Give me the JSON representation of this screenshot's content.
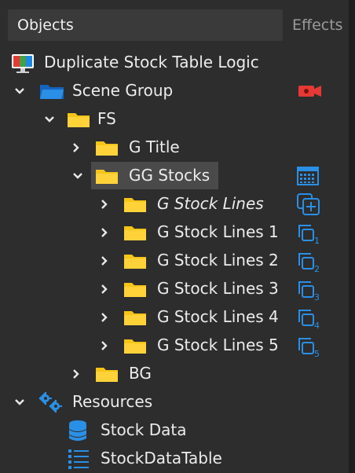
{
  "header": {
    "objects_tab": "Objects",
    "effects_tab": "Effects"
  },
  "tree": {
    "root_label": "Duplicate Stock Table Logic",
    "scene_group": "Scene Group",
    "fs": "FS",
    "g_title": "G Title",
    "gg_stocks": "GG Stocks",
    "g_stock_lines": "G Stock Lines",
    "g_stock_lines_1": "G Stock Lines 1",
    "g_stock_lines_2": "G Stock Lines 2",
    "g_stock_lines_3": "G Stock Lines 3",
    "g_stock_lines_4": "G Stock Lines 4",
    "g_stock_lines_5": "G Stock Lines 5",
    "bg": "BG",
    "resources": "Resources",
    "stock_data": "Stock Data",
    "stock_data_table": "StockDataTable",
    "dup_indices": [
      "1",
      "2",
      "3",
      "4",
      "5"
    ]
  },
  "colors": {
    "folder_yellow": "#f5c518",
    "scene_blue": "#1e88e5",
    "accent_blue": "#2a8fe6",
    "record_red": "#e53935",
    "selected_bg": "#4a4a4a"
  },
  "icons": {
    "root": "monitor-icon",
    "scene": "blue-folder-icon",
    "camera": "record-icon",
    "table_grid": "grid-table-icon",
    "add_copy": "add-duplicate-icon",
    "dup": "duplicate-numbered-icon",
    "resources": "gears-icon",
    "stock_data": "database-icon",
    "stock_data_table": "list-icon"
  }
}
